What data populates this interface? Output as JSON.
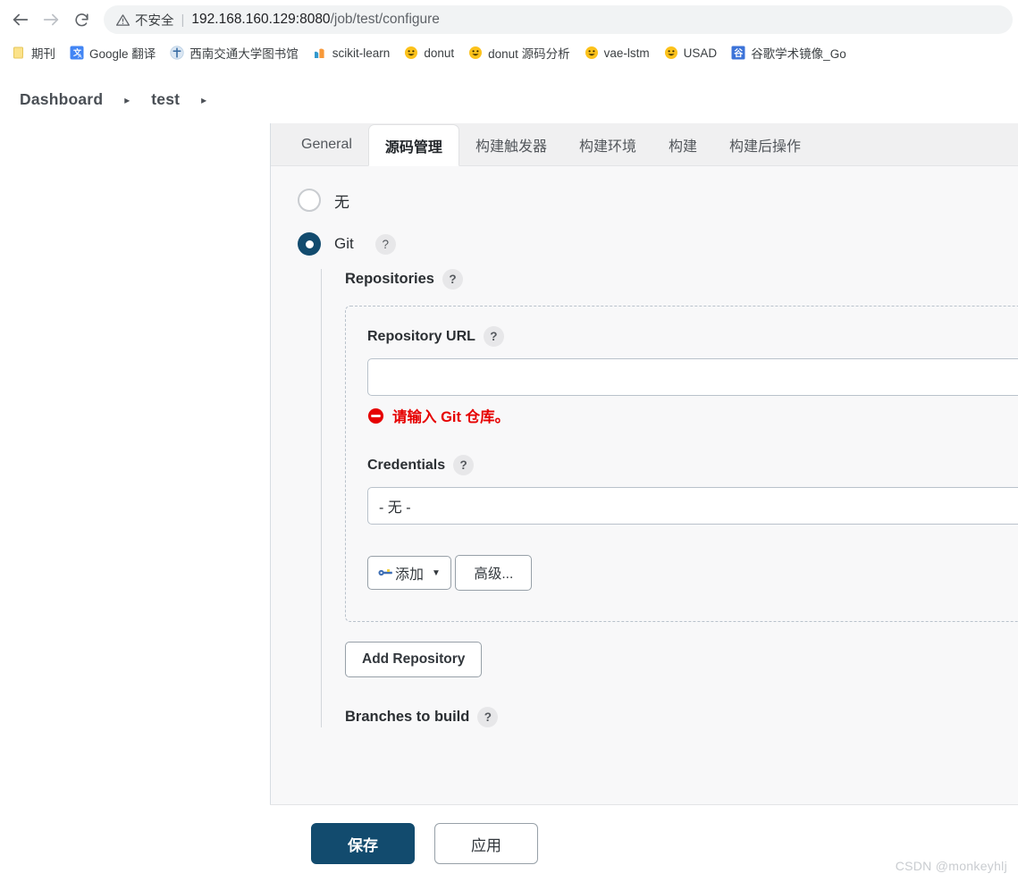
{
  "browser": {
    "nav": {
      "back_icon": "arrow-left-icon",
      "forward_icon": "arrow-right-icon",
      "reload_icon": "reload-icon"
    },
    "omnibox": {
      "warning_icon": "warning-triangle-icon",
      "security_label": "不安全",
      "separator": "|",
      "url_host": "192.168.160.129:8080",
      "url_path": "/job/test/configure"
    },
    "bookmarks": [
      {
        "label": "期刊",
        "icon": "folder-note-icon"
      },
      {
        "label": "Google 翻译",
        "icon": "google-translate-icon"
      },
      {
        "label": "西南交通大学图书馆",
        "icon": "university-crest-icon"
      },
      {
        "label": "scikit-learn",
        "icon": "scikit-learn-icon"
      },
      {
        "label": "donut",
        "icon": "smiley-icon"
      },
      {
        "label": "donut 源码分析",
        "icon": "smiley-icon"
      },
      {
        "label": "vae-lstm",
        "icon": "smiley-icon"
      },
      {
        "label": "USAD",
        "icon": "smiley-icon"
      },
      {
        "label": "谷歌学术镜像_Go",
        "icon": "scholar-mirror-icon"
      }
    ]
  },
  "breadcrumb": {
    "items": [
      "Dashboard",
      "test"
    ],
    "separator": "▸",
    "trailing_separator": "▸"
  },
  "tabs": [
    {
      "label": "General",
      "active": false
    },
    {
      "label": "源码管理",
      "active": true
    },
    {
      "label": "构建触发器",
      "active": false
    },
    {
      "label": "构建环境",
      "active": false
    },
    {
      "label": "构建",
      "active": false
    },
    {
      "label": "构建后操作",
      "active": false
    }
  ],
  "scm": {
    "options": [
      {
        "label": "无",
        "checked": false
      },
      {
        "label": "Git",
        "checked": true,
        "help": "?"
      }
    ],
    "repositories": {
      "title": "Repositories",
      "help": "?",
      "repository_url": {
        "label": "Repository URL",
        "help": "?",
        "value": "",
        "error_text": "请输入 Git 仓库。",
        "error_icon": "no-entry-icon"
      },
      "credentials": {
        "label": "Credentials",
        "help": "?",
        "selected": "- 无 -",
        "add_button": {
          "label": "添加",
          "icon": "key-icon",
          "caret": "▼"
        }
      },
      "advanced_button": "高级..."
    },
    "add_repository_button": "Add Repository",
    "branches_to_build": {
      "label": "Branches to build",
      "help": "?"
    }
  },
  "footer": {
    "save_button": "保存",
    "apply_button": "应用",
    "watermark": "CSDN @monkeyhlj"
  },
  "colors": {
    "accent_navy": "#124b6e",
    "error_red": "#e60000",
    "panel_bg": "#f8f8f9"
  }
}
